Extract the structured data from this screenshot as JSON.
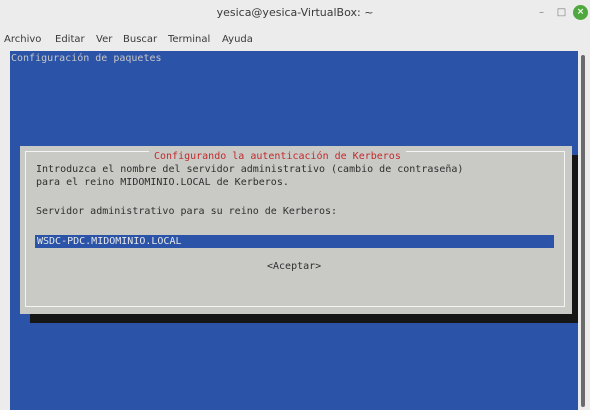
{
  "window": {
    "title": "yesica@yesica-VirtualBox: ~",
    "minimize_glyph": "–",
    "maximize_glyph": "□",
    "close_glyph": "×"
  },
  "menu": {
    "items": [
      {
        "label": "Archivo"
      },
      {
        "label": "Editar"
      },
      {
        "label": "Ver"
      },
      {
        "label": "Buscar"
      },
      {
        "label": "Terminal"
      },
      {
        "label": "Ayuda"
      }
    ]
  },
  "terminal": {
    "header": "Configuración de paquetes",
    "bg_color": "#2b54a8"
  },
  "dialog": {
    "title": "Configurando la autenticación de Kerberos",
    "line1": "Introduzca el nombre del servidor administrativo (cambio de contraseña)",
    "line2": "para el reino MIDOMINIO.LOCAL de Kerberos.",
    "prompt": "Servidor administrativo para su reino de Kerberos:",
    "input_value": "WSDC-PDC.MIDOMINIO.LOCAL",
    "accept_label": "<Aceptar>",
    "title_color": "#c22b2b"
  }
}
